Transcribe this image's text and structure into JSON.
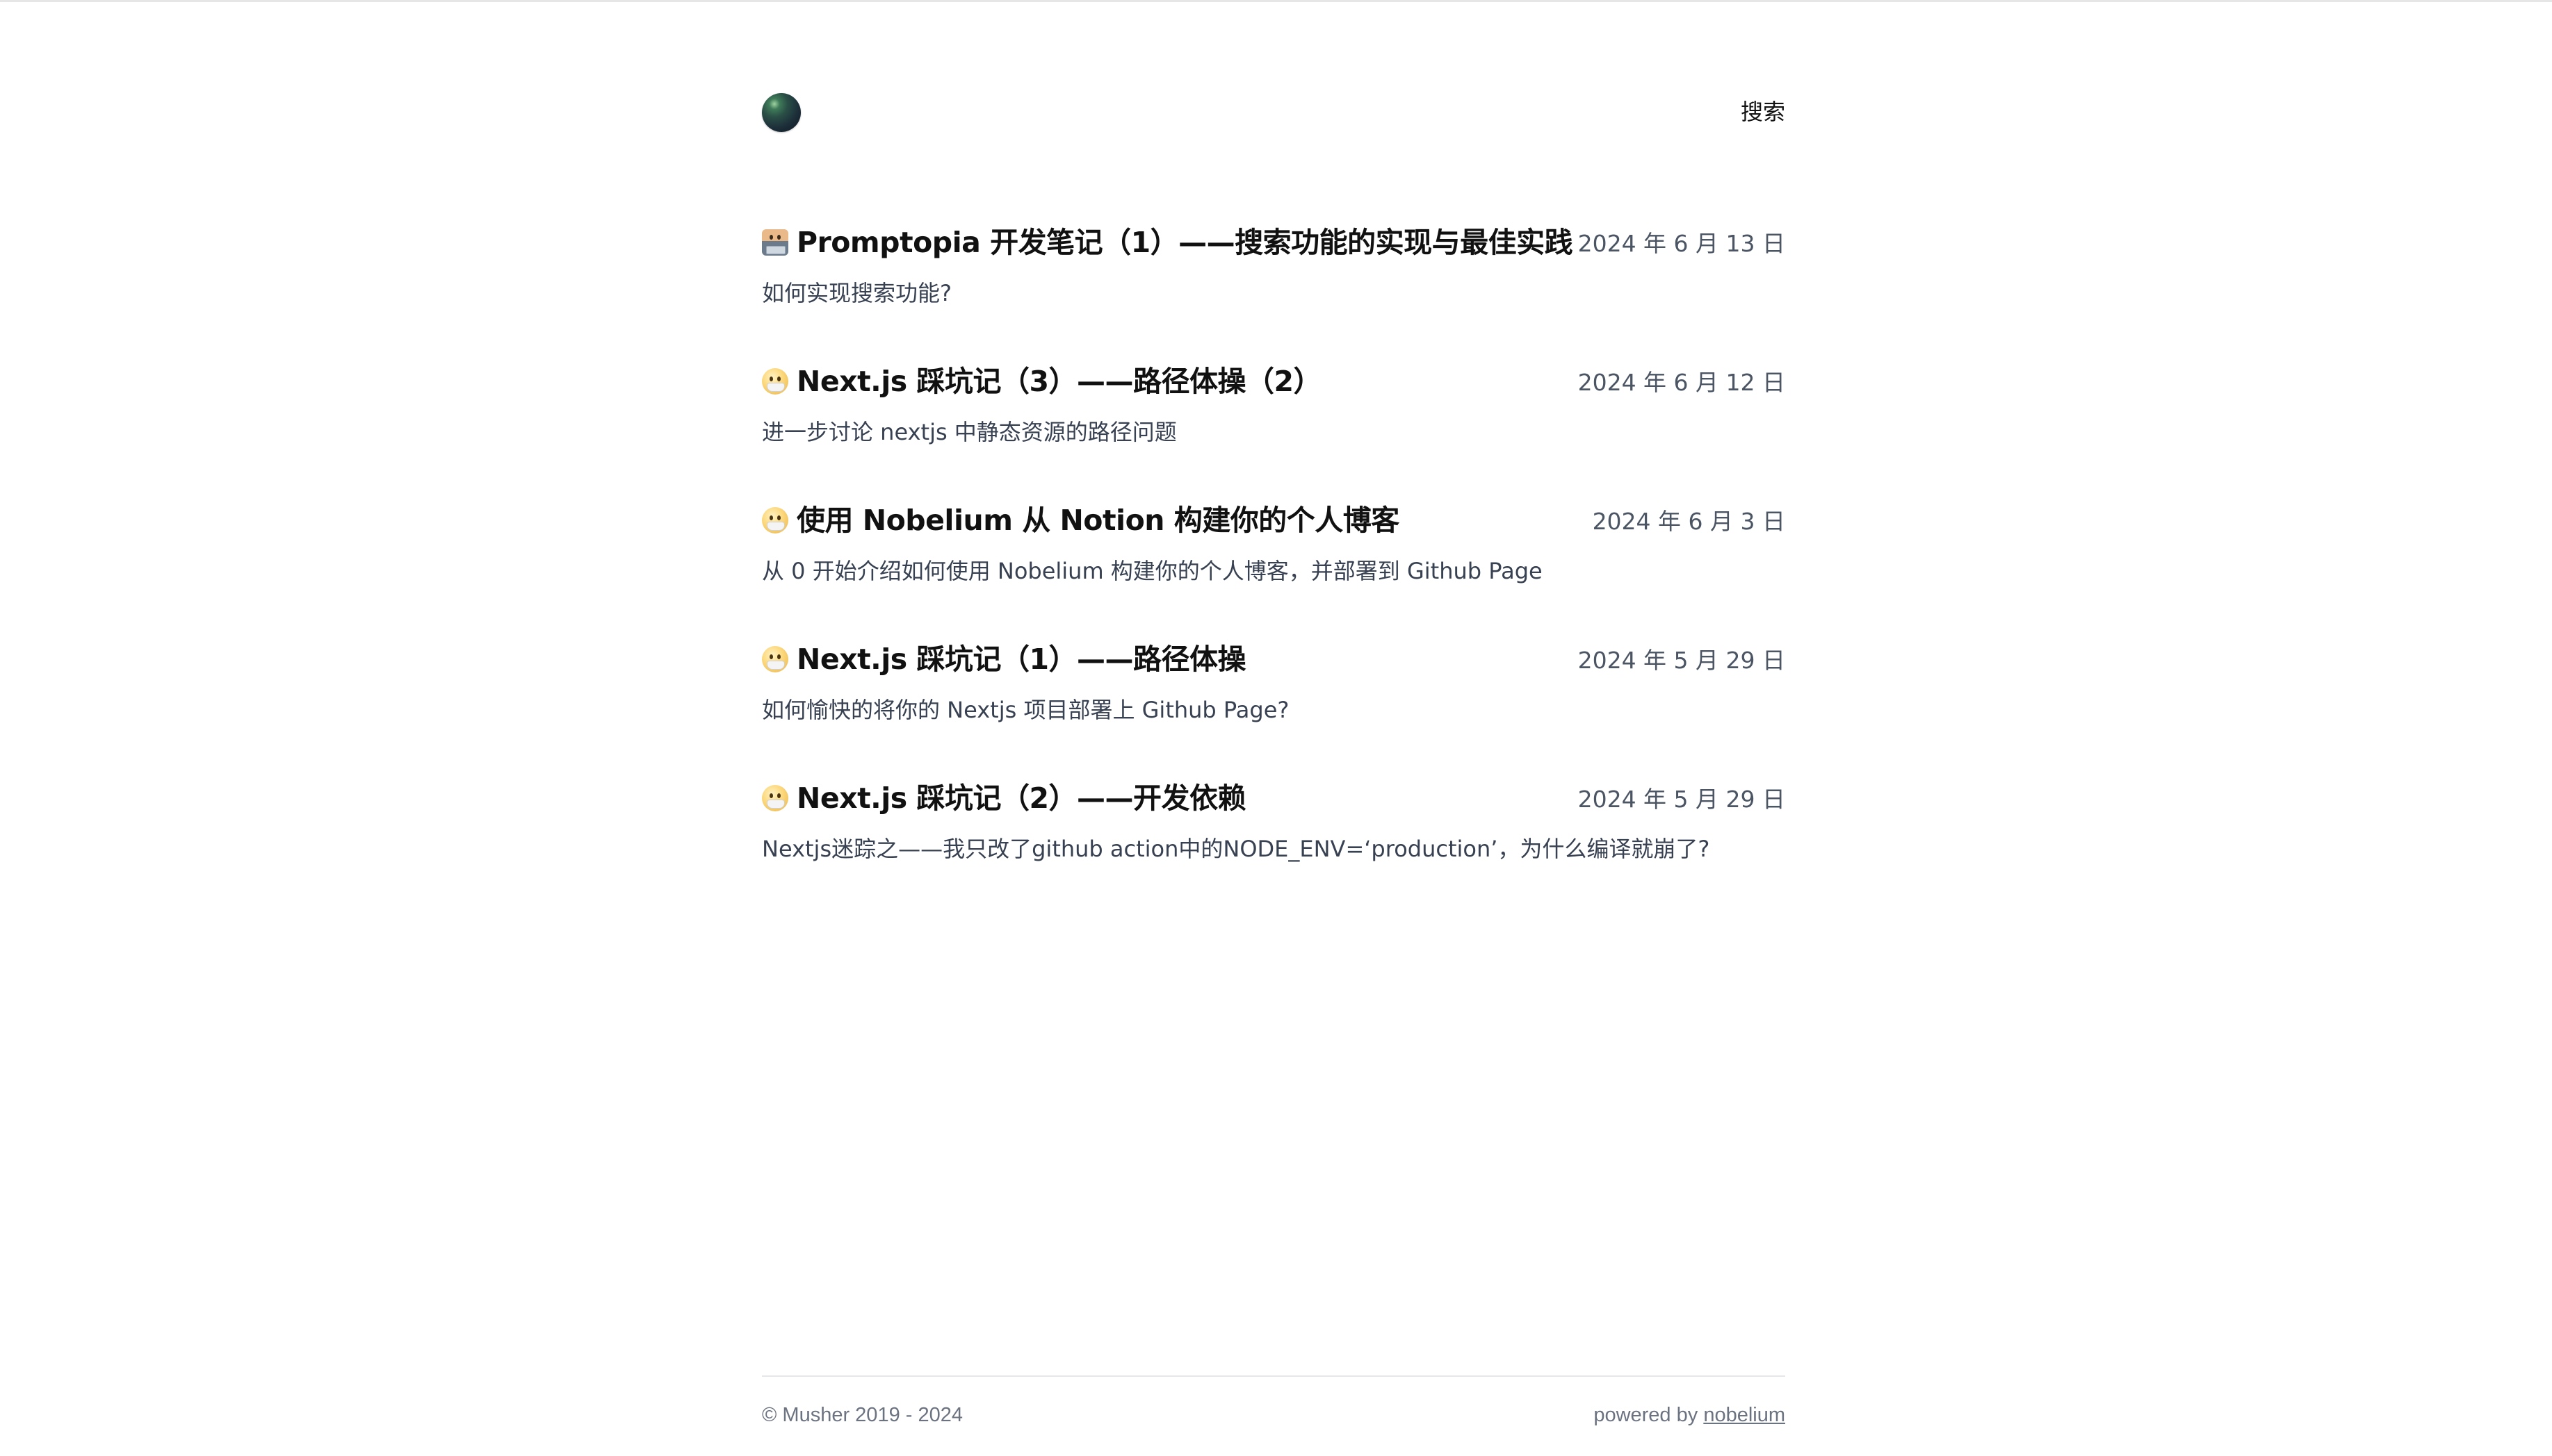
{
  "header": {
    "logo_icon": "blog-logo-icon",
    "search_label": "搜索"
  },
  "posts": [
    {
      "emoji": "technologist-emoji",
      "title": "Promptopia 开发笔记（1）——搜索功能的实现与最佳实践",
      "date": "2024 年 6 月 13 日",
      "summary": "如何实现搜索功能?"
    },
    {
      "emoji": "face-with-medical-mask-emoji",
      "title": "Next.js 踩坑记（3）——路径体操（2）",
      "date": "2024 年 6 月 12 日",
      "summary": "进一步讨论 nextjs 中静态资源的路径问题"
    },
    {
      "emoji": "face-with-medical-mask-emoji",
      "title": "使用 Nobelium 从 Notion 构建你的个人博客",
      "date": "2024 年 6 月 3 日",
      "summary": "从 0 开始介绍如何使用 Nobelium 构建你的个人博客，并部署到 Github Page"
    },
    {
      "emoji": "face-with-medical-mask-emoji",
      "title": "Next.js 踩坑记（1）——路径体操",
      "date": "2024 年 5 月 29 日",
      "summary": "如何愉快的将你的 Nextjs 项目部署上 Github Page?"
    },
    {
      "emoji": "face-with-medical-mask-emoji",
      "title": "Next.js 踩坑记（2）——开发依赖",
      "date": "2024 年 5 月 29 日",
      "summary": "Nextjs迷踪之——我只改了github action中的NODE_ENV=‘production’，为什么编译就崩了?"
    }
  ],
  "footer": {
    "copyright": "© Musher 2019 - 2024",
    "powered_prefix": "powered by ",
    "powered_link": "nobelium"
  }
}
